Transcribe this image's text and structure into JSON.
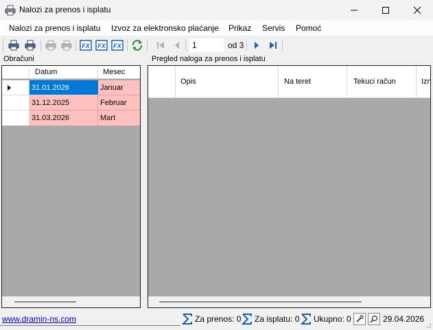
{
  "window": {
    "title": "Nalozi za prenos i isplatu"
  },
  "menu": {
    "items": [
      "Nalozi za prenos i isplatu",
      "Izvoz za elektronsko plaćanje",
      "Prikaz",
      "Servis",
      "Pomoć"
    ]
  },
  "toolbar": {
    "page_value": "1",
    "page_of": "od 3"
  },
  "left_panel": {
    "title": "Obračuni",
    "columns": [
      "Datum",
      "Mesec"
    ],
    "rows": [
      {
        "datum": "31.01.2026",
        "mesec": "Januar",
        "selected": true
      },
      {
        "datum": "31.12.2025",
        "mesec": "Februar",
        "selected": false
      },
      {
        "datum": "31.03.2026",
        "mesec": "Mart",
        "selected": false
      }
    ]
  },
  "right_panel": {
    "title": "Pregled naloga za prenos i isplatu",
    "columns": [
      "Opis",
      "Na teret",
      "Tekuci račun",
      "Izn"
    ]
  },
  "status": {
    "link": "www.dramin-ns.com",
    "za_prenos": "Za prenos: 0",
    "za_isplatu": "Za isplatu: 0",
    "ukupno": "Ukupno: 0",
    "date": "29.04.2026"
  },
  "colors": {
    "selected_cell": "#0078d7",
    "mesec_cell": "#ffc0c0",
    "grid_bg": "#a9a9a9",
    "link": "#0000cc"
  }
}
